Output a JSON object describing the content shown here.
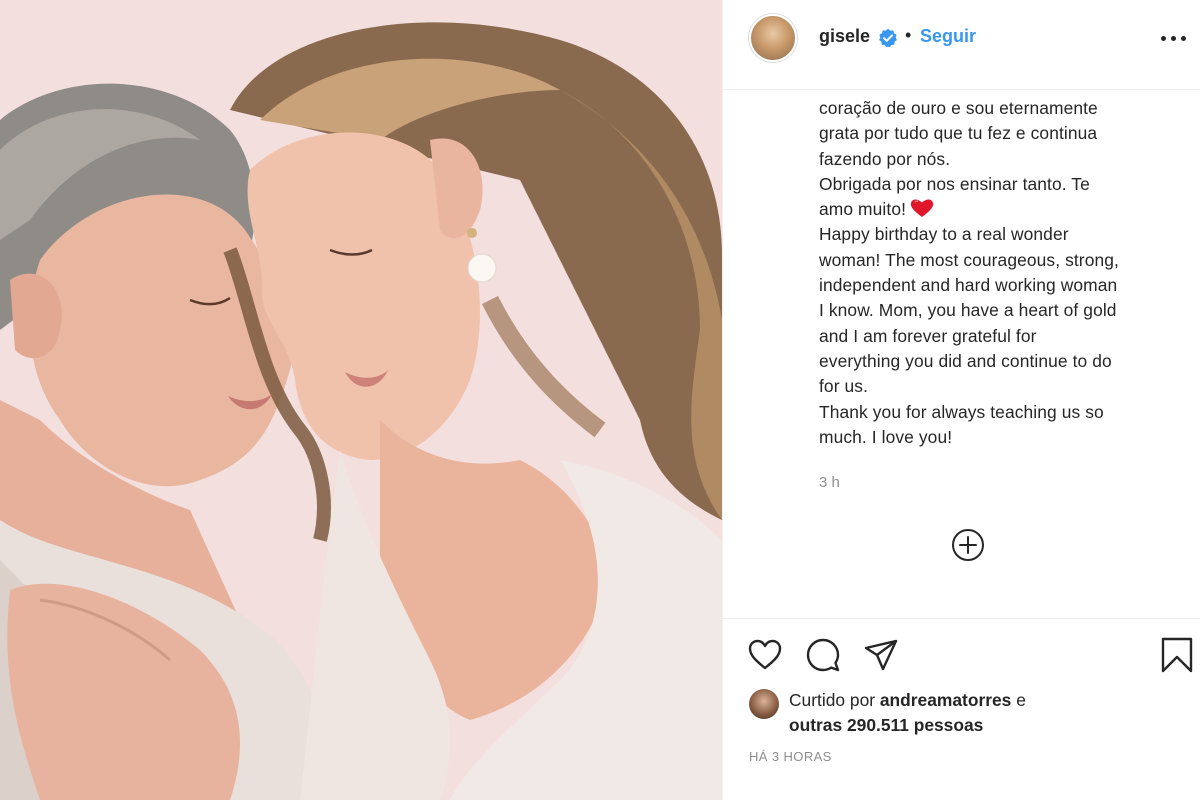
{
  "post": {
    "username": "gisele",
    "follow_label": "Seguir",
    "separator": "•",
    "caption_lines": [
      "coração de ouro e sou eternamente",
      "grata por tudo que tu fez e continua",
      "fazendo por nós.",
      "Obrigada por nos ensinar tanto. Te",
      "amo muito!",
      "Happy birthday to a real wonder",
      "woman! The most courageous, strong,",
      "independent and hard working woman",
      "I know. Mom, you have a heart of gold",
      "and I am forever grateful for",
      "everything you did and continue to do",
      "for us.",
      "Thank you for always teaching us so",
      "much. I love you!"
    ],
    "caption_time": "3 h"
  },
  "icons": {
    "verified": "verified-badge-icon",
    "more": "more-options-icon",
    "heart_emoji": "red-heart-emoji",
    "load_more": "load-more-comments-icon",
    "like": "heart-outline-icon",
    "comment": "comment-icon",
    "share": "paper-plane-icon",
    "save": "bookmark-icon"
  },
  "likes": {
    "prefix": "Curtido por",
    "user": "andreamatorres",
    "conjunction": "e",
    "others": "outras 290.511 pessoas"
  },
  "posted_ago": "HÁ 3 HORAS",
  "colors": {
    "accent": "#3897f0",
    "text": "#262626",
    "muted": "#8e8e8e",
    "heart": "#e0162b",
    "photo_bg": "#f3dcdc"
  }
}
